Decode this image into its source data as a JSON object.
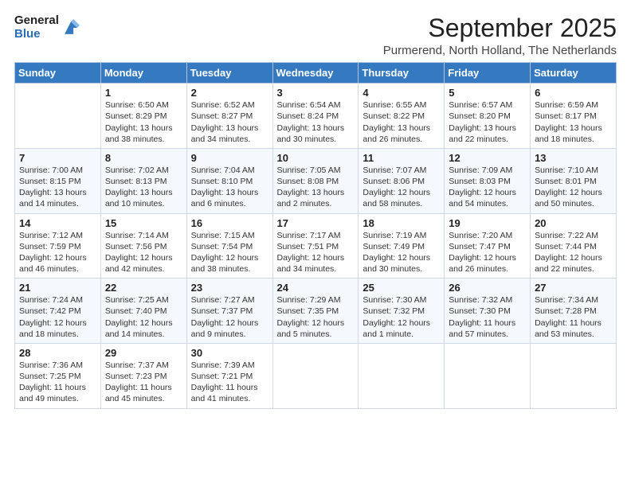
{
  "logo": {
    "general": "General",
    "blue": "Blue"
  },
  "header": {
    "month": "September 2025",
    "location": "Purmerend, North Holland, The Netherlands"
  },
  "weekdays": [
    "Sunday",
    "Monday",
    "Tuesday",
    "Wednesday",
    "Thursday",
    "Friday",
    "Saturday"
  ],
  "weeks": [
    [
      {
        "day": "",
        "info": ""
      },
      {
        "day": "1",
        "info": "Sunrise: 6:50 AM\nSunset: 8:29 PM\nDaylight: 13 hours\nand 38 minutes."
      },
      {
        "day": "2",
        "info": "Sunrise: 6:52 AM\nSunset: 8:27 PM\nDaylight: 13 hours\nand 34 minutes."
      },
      {
        "day": "3",
        "info": "Sunrise: 6:54 AM\nSunset: 8:24 PM\nDaylight: 13 hours\nand 30 minutes."
      },
      {
        "day": "4",
        "info": "Sunrise: 6:55 AM\nSunset: 8:22 PM\nDaylight: 13 hours\nand 26 minutes."
      },
      {
        "day": "5",
        "info": "Sunrise: 6:57 AM\nSunset: 8:20 PM\nDaylight: 13 hours\nand 22 minutes."
      },
      {
        "day": "6",
        "info": "Sunrise: 6:59 AM\nSunset: 8:17 PM\nDaylight: 13 hours\nand 18 minutes."
      }
    ],
    [
      {
        "day": "7",
        "info": "Sunrise: 7:00 AM\nSunset: 8:15 PM\nDaylight: 13 hours\nand 14 minutes."
      },
      {
        "day": "8",
        "info": "Sunrise: 7:02 AM\nSunset: 8:13 PM\nDaylight: 13 hours\nand 10 minutes."
      },
      {
        "day": "9",
        "info": "Sunrise: 7:04 AM\nSunset: 8:10 PM\nDaylight: 13 hours\nand 6 minutes."
      },
      {
        "day": "10",
        "info": "Sunrise: 7:05 AM\nSunset: 8:08 PM\nDaylight: 13 hours\nand 2 minutes."
      },
      {
        "day": "11",
        "info": "Sunrise: 7:07 AM\nSunset: 8:06 PM\nDaylight: 12 hours\nand 58 minutes."
      },
      {
        "day": "12",
        "info": "Sunrise: 7:09 AM\nSunset: 8:03 PM\nDaylight: 12 hours\nand 54 minutes."
      },
      {
        "day": "13",
        "info": "Sunrise: 7:10 AM\nSunset: 8:01 PM\nDaylight: 12 hours\nand 50 minutes."
      }
    ],
    [
      {
        "day": "14",
        "info": "Sunrise: 7:12 AM\nSunset: 7:59 PM\nDaylight: 12 hours\nand 46 minutes."
      },
      {
        "day": "15",
        "info": "Sunrise: 7:14 AM\nSunset: 7:56 PM\nDaylight: 12 hours\nand 42 minutes."
      },
      {
        "day": "16",
        "info": "Sunrise: 7:15 AM\nSunset: 7:54 PM\nDaylight: 12 hours\nand 38 minutes."
      },
      {
        "day": "17",
        "info": "Sunrise: 7:17 AM\nSunset: 7:51 PM\nDaylight: 12 hours\nand 34 minutes."
      },
      {
        "day": "18",
        "info": "Sunrise: 7:19 AM\nSunset: 7:49 PM\nDaylight: 12 hours\nand 30 minutes."
      },
      {
        "day": "19",
        "info": "Sunrise: 7:20 AM\nSunset: 7:47 PM\nDaylight: 12 hours\nand 26 minutes."
      },
      {
        "day": "20",
        "info": "Sunrise: 7:22 AM\nSunset: 7:44 PM\nDaylight: 12 hours\nand 22 minutes."
      }
    ],
    [
      {
        "day": "21",
        "info": "Sunrise: 7:24 AM\nSunset: 7:42 PM\nDaylight: 12 hours\nand 18 minutes."
      },
      {
        "day": "22",
        "info": "Sunrise: 7:25 AM\nSunset: 7:40 PM\nDaylight: 12 hours\nand 14 minutes."
      },
      {
        "day": "23",
        "info": "Sunrise: 7:27 AM\nSunset: 7:37 PM\nDaylight: 12 hours\nand 9 minutes."
      },
      {
        "day": "24",
        "info": "Sunrise: 7:29 AM\nSunset: 7:35 PM\nDaylight: 12 hours\nand 5 minutes."
      },
      {
        "day": "25",
        "info": "Sunrise: 7:30 AM\nSunset: 7:32 PM\nDaylight: 12 hours\nand 1 minute."
      },
      {
        "day": "26",
        "info": "Sunrise: 7:32 AM\nSunset: 7:30 PM\nDaylight: 11 hours\nand 57 minutes."
      },
      {
        "day": "27",
        "info": "Sunrise: 7:34 AM\nSunset: 7:28 PM\nDaylight: 11 hours\nand 53 minutes."
      }
    ],
    [
      {
        "day": "28",
        "info": "Sunrise: 7:36 AM\nSunset: 7:25 PM\nDaylight: 11 hours\nand 49 minutes."
      },
      {
        "day": "29",
        "info": "Sunrise: 7:37 AM\nSunset: 7:23 PM\nDaylight: 11 hours\nand 45 minutes."
      },
      {
        "day": "30",
        "info": "Sunrise: 7:39 AM\nSunset: 7:21 PM\nDaylight: 11 hours\nand 41 minutes."
      },
      {
        "day": "",
        "info": ""
      },
      {
        "day": "",
        "info": ""
      },
      {
        "day": "",
        "info": ""
      },
      {
        "day": "",
        "info": ""
      }
    ]
  ]
}
